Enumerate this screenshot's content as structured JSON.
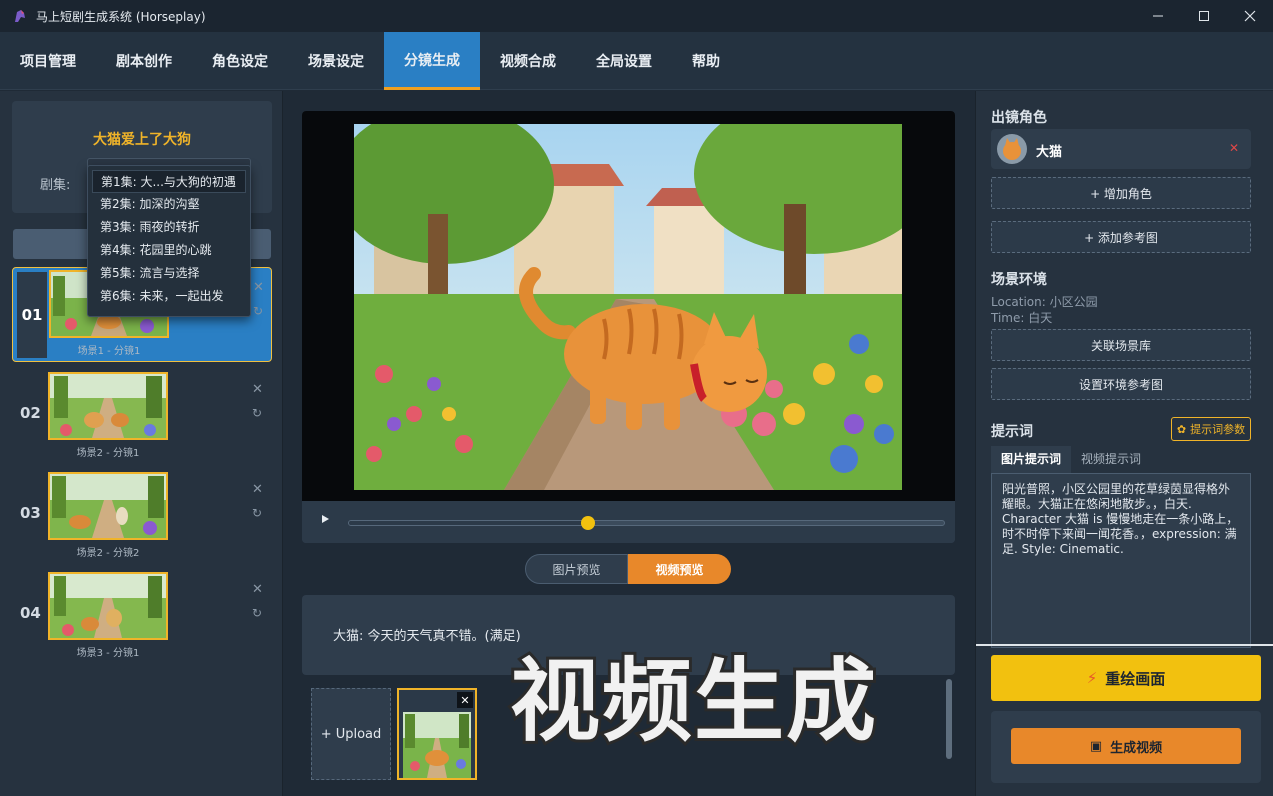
{
  "window": {
    "title": "马上短剧生成系统 (Horseplay)"
  },
  "menu": [
    {
      "label": "项目管理"
    },
    {
      "label": "剧本创作"
    },
    {
      "label": "角色设定"
    },
    {
      "label": "场景设定"
    },
    {
      "label": "分镜生成",
      "active": true
    },
    {
      "label": "视频合成"
    },
    {
      "label": "全局设置"
    },
    {
      "label": "帮助"
    }
  ],
  "project": {
    "title": "大猫爱上了大狗",
    "episode_label": "剧集:"
  },
  "episodes": [
    "第1集: 大...与大狗的初遇",
    "第2集: 加深的沟壑",
    "第3集: 雨夜的转折",
    "第4集: 花园里的心跳",
    "第5集: 流言与选择",
    "第6集: 未来，一起出发"
  ],
  "scenes": [
    {
      "num": "01",
      "caption": "场景1 - 分镜1"
    },
    {
      "num": "02",
      "caption": "场景2 - 分镜1"
    },
    {
      "num": "03",
      "caption": "场景2 - 分镜2"
    },
    {
      "num": "04",
      "caption": "场景3 - 分镜1"
    }
  ],
  "player": {
    "progress": 0.4
  },
  "preview": {
    "image_label": "图片预览",
    "video_label": "视频预览"
  },
  "dialog": {
    "text": "大猫: 今天的天气真不错。(满足)"
  },
  "references": {
    "upload_label": "+ Upload"
  },
  "overlay_text": "视频生成",
  "right": {
    "characters_title": "出镜角色",
    "character_name": "大猫",
    "add_character": "+ 增加角色",
    "add_reference": "+ 添加参考图",
    "environment_title": "场景环境",
    "location": "Location: 小区公园",
    "time": "Time: 白天",
    "link_scene_lib": "关联场景库",
    "set_env_ref": "设置环境参考图",
    "prompt_title": "提示词",
    "prompt_params": "提示词参数",
    "tab_image_prompt": "图片提示词",
    "tab_video_prompt": "视频提示词",
    "prompt_text": "阳光普照，小区公园里的花草绿茵显得格外耀眼。大猫正在悠闲地散步。，白天. Character 大猫  is 慢慢地走在一条小路上，时不时停下来闻一闻花香。，expression: 满足. Style: Cinematic.",
    "redraw": "重绘画面",
    "generate_video": "生成视频"
  },
  "colors": {
    "accent": "#2a7fc4",
    "highlight": "#f0b429",
    "orange": "#e8882a",
    "yellow": "#f2c10f"
  }
}
